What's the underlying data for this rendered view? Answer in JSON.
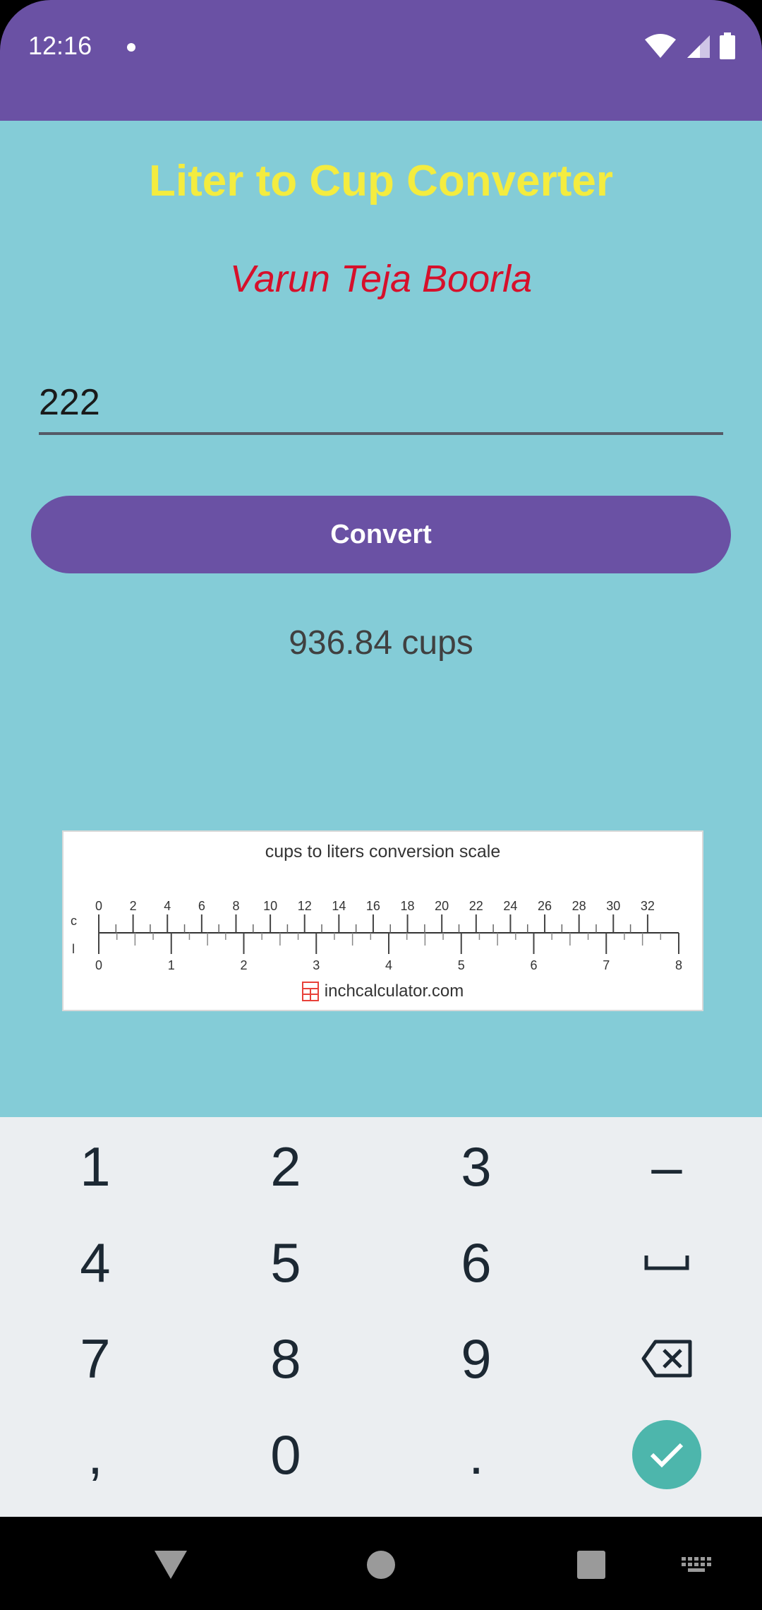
{
  "status_bar": {
    "time": "12:16",
    "bg_color": "#6a51a4",
    "icons": [
      "notification-dot-icon",
      "wifi-icon",
      "signal-icon",
      "battery-icon"
    ]
  },
  "app": {
    "title": "Liter to Cup Converter",
    "author": "Varun Teja Boorla",
    "bg_color": "#84ccd7",
    "title_color": "#f4ec3f",
    "author_color": "#d6102b"
  },
  "input": {
    "value": "222"
  },
  "convert_button": {
    "label": "Convert",
    "color": "#6a51a4"
  },
  "result": {
    "text": "936.84 cups"
  },
  "scale_image": {
    "title": "cups to liters conversion scale",
    "cup_row_label": "c",
    "liter_row_label": "l",
    "cup_ticks": [
      "0",
      "2",
      "4",
      "6",
      "8",
      "10",
      "12",
      "14",
      "16",
      "18",
      "20",
      "22",
      "24",
      "26",
      "28",
      "30",
      "32"
    ],
    "liter_ticks": [
      "0",
      "1",
      "2",
      "3",
      "4",
      "5",
      "6",
      "7",
      "8"
    ],
    "footer": "inchcalculator.com"
  },
  "keyboard": {
    "rows": [
      [
        "1",
        "2",
        "3",
        "–"
      ],
      [
        "4",
        "5",
        "6",
        "space-icon"
      ],
      [
        "7",
        "8",
        "9",
        "backspace-icon"
      ],
      [
        ",",
        "0",
        ".",
        "check-icon"
      ]
    ],
    "accent": "#4db6ac"
  },
  "nav_bar": {
    "icons": [
      "back-icon",
      "home-icon",
      "recents-icon",
      "keyboard-switch-icon"
    ]
  }
}
